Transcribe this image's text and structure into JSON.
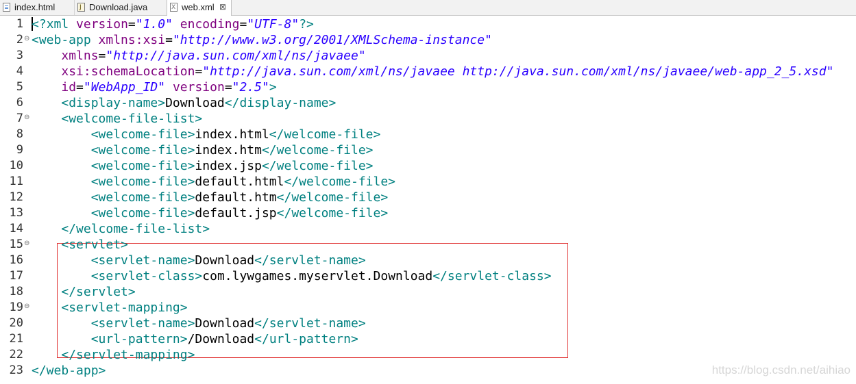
{
  "tabs": [
    {
      "label": "index.html",
      "icon": "html-file-icon",
      "active": false
    },
    {
      "label": "Download.java",
      "icon": "java-file-icon",
      "active": false
    },
    {
      "label": "web.xml",
      "icon": "xml-file-icon",
      "active": true,
      "close": "⊠"
    }
  ],
  "editor": {
    "fold_marker": "⊖",
    "lines": [
      {
        "n": "1",
        "segs": [
          [
            "p",
            "<?"
          ],
          [
            "t",
            "xml"
          ],
          [
            "x",
            " "
          ],
          [
            "a",
            "version"
          ],
          [
            "x",
            "="
          ],
          [
            "v",
            "\"1.0\""
          ],
          [
            "x",
            " "
          ],
          [
            "a",
            "encoding"
          ],
          [
            "x",
            "="
          ],
          [
            "v",
            "\"UTF-8\""
          ],
          [
            "p",
            "?>"
          ]
        ]
      },
      {
        "n": "2",
        "fold": true,
        "segs": [
          [
            "t",
            "<web-app"
          ],
          [
            "x",
            " "
          ],
          [
            "a",
            "xmlns:xsi"
          ],
          [
            "x",
            "="
          ],
          [
            "v",
            "\"http://www.w3.org/2001/XMLSchema-instance\""
          ]
        ]
      },
      {
        "n": "3",
        "segs": [
          [
            "x",
            "    "
          ],
          [
            "a",
            "xmlns"
          ],
          [
            "x",
            "="
          ],
          [
            "v",
            "\"http://java.sun.com/xml/ns/javaee\""
          ]
        ]
      },
      {
        "n": "4",
        "segs": [
          [
            "x",
            "    "
          ],
          [
            "a",
            "xsi:schemaLocation"
          ],
          [
            "x",
            "="
          ],
          [
            "v",
            "\"http://java.sun.com/xml/ns/javaee http://java.sun.com/xml/ns/javaee/web-app_2_5.xsd\""
          ]
        ]
      },
      {
        "n": "5",
        "segs": [
          [
            "x",
            "    "
          ],
          [
            "a",
            "id"
          ],
          [
            "x",
            "="
          ],
          [
            "v",
            "\"WebApp_ID\""
          ],
          [
            "x",
            " "
          ],
          [
            "a",
            "version"
          ],
          [
            "x",
            "="
          ],
          [
            "v",
            "\"2.5\""
          ],
          [
            "t",
            ">"
          ]
        ]
      },
      {
        "n": "6",
        "segs": [
          [
            "x",
            "    "
          ],
          [
            "t",
            "<display-name>"
          ],
          [
            "x",
            "Download"
          ],
          [
            "t",
            "</display-name>"
          ]
        ]
      },
      {
        "n": "7",
        "fold": true,
        "segs": [
          [
            "x",
            "    "
          ],
          [
            "t",
            "<welcome-file-list>"
          ]
        ]
      },
      {
        "n": "8",
        "segs": [
          [
            "x",
            "        "
          ],
          [
            "t",
            "<welcome-file>"
          ],
          [
            "x",
            "index.html"
          ],
          [
            "t",
            "</welcome-file>"
          ]
        ]
      },
      {
        "n": "9",
        "segs": [
          [
            "x",
            "        "
          ],
          [
            "t",
            "<welcome-file>"
          ],
          [
            "x",
            "index.htm"
          ],
          [
            "t",
            "</welcome-file>"
          ]
        ]
      },
      {
        "n": "10",
        "segs": [
          [
            "x",
            "        "
          ],
          [
            "t",
            "<welcome-file>"
          ],
          [
            "x",
            "index.jsp"
          ],
          [
            "t",
            "</welcome-file>"
          ]
        ]
      },
      {
        "n": "11",
        "segs": [
          [
            "x",
            "        "
          ],
          [
            "t",
            "<welcome-file>"
          ],
          [
            "x",
            "default.html"
          ],
          [
            "t",
            "</welcome-file>"
          ]
        ]
      },
      {
        "n": "12",
        "segs": [
          [
            "x",
            "        "
          ],
          [
            "t",
            "<welcome-file>"
          ],
          [
            "x",
            "default.htm"
          ],
          [
            "t",
            "</welcome-file>"
          ]
        ]
      },
      {
        "n": "13",
        "segs": [
          [
            "x",
            "        "
          ],
          [
            "t",
            "<welcome-file>"
          ],
          [
            "x",
            "default.jsp"
          ],
          [
            "t",
            "</welcome-file>"
          ]
        ]
      },
      {
        "n": "14",
        "segs": [
          [
            "x",
            "    "
          ],
          [
            "t",
            "</welcome-file-list>"
          ]
        ]
      },
      {
        "n": "15",
        "fold": true,
        "segs": [
          [
            "x",
            "    "
          ],
          [
            "t",
            "<servlet>"
          ]
        ]
      },
      {
        "n": "16",
        "segs": [
          [
            "x",
            "        "
          ],
          [
            "t",
            "<servlet-name>"
          ],
          [
            "x",
            "Download"
          ],
          [
            "t",
            "</servlet-name>"
          ]
        ]
      },
      {
        "n": "17",
        "segs": [
          [
            "x",
            "        "
          ],
          [
            "t",
            "<servlet-class>"
          ],
          [
            "x",
            "com.lywgames.myservlet.Download"
          ],
          [
            "t",
            "</servlet-class>"
          ]
        ]
      },
      {
        "n": "18",
        "segs": [
          [
            "x",
            "    "
          ],
          [
            "t",
            "</servlet>"
          ]
        ]
      },
      {
        "n": "19",
        "fold": true,
        "segs": [
          [
            "x",
            "    "
          ],
          [
            "t",
            "<servlet-mapping>"
          ]
        ]
      },
      {
        "n": "20",
        "segs": [
          [
            "x",
            "        "
          ],
          [
            "t",
            "<servlet-name>"
          ],
          [
            "x",
            "Download"
          ],
          [
            "t",
            "</servlet-name>"
          ]
        ]
      },
      {
        "n": "21",
        "segs": [
          [
            "x",
            "        "
          ],
          [
            "t",
            "<url-pattern>"
          ],
          [
            "x",
            "/Download"
          ],
          [
            "t",
            "</url-pattern>"
          ]
        ]
      },
      {
        "n": "22",
        "segs": [
          [
            "x",
            "    "
          ],
          [
            "t",
            "</servlet-mapping>"
          ]
        ]
      },
      {
        "n": "23",
        "segs": [
          [
            "t",
            "</web-app>"
          ]
        ]
      }
    ]
  },
  "colors": {
    "tag": "#008080",
    "attribute": "#7f007f",
    "value": "#2a00ff",
    "text": "#000000",
    "highlight_border": "#e03030"
  },
  "watermark": "https://blog.csdn.net/aihiao"
}
